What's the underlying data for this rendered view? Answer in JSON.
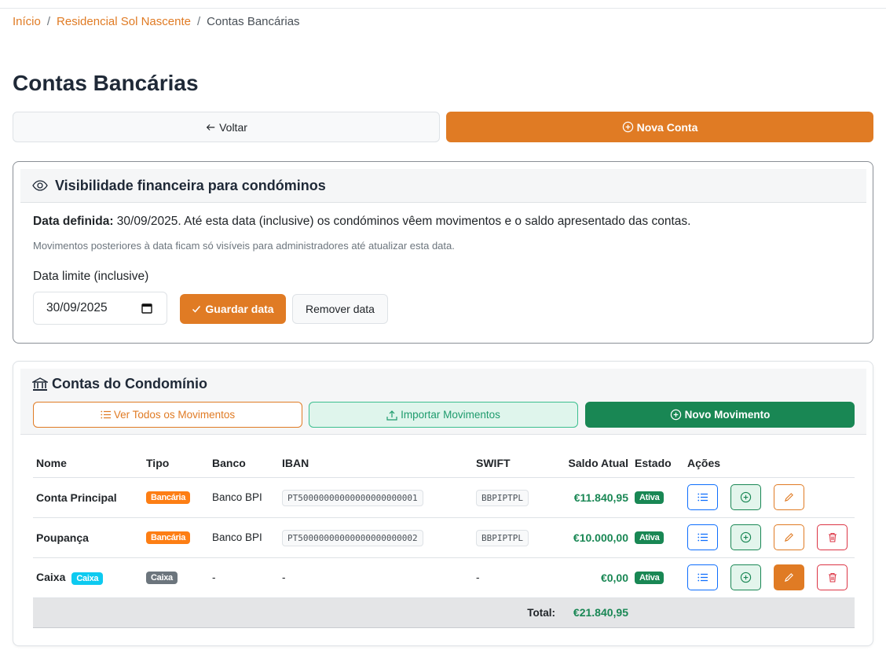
{
  "breadcrumb": {
    "home": "Início",
    "condo": "Residencial Sol Nascente",
    "current": "Contas Bancárias"
  },
  "page_title": "Contas Bancárias",
  "actions": {
    "back_label": "Voltar",
    "new_label": "Nova Conta"
  },
  "visibility": {
    "title": "Visibilidade financeira para condóminos",
    "defined_label": "Data definida:",
    "defined_text": " 30/09/2025. Até esta data (inclusive) os condóminos vêem movimentos e o saldo apresentado das contas.",
    "note": "Movimentos posteriores à data ficam só visíveis para administradores até atualizar esta data.",
    "limit_label": "Data limite (inclusive)",
    "date_value": "30/09/2025",
    "save_label": "Guardar data",
    "remove_label": "Remover data"
  },
  "accounts": {
    "title": "Contas do Condomínio",
    "btn_movements": "Ver Todos os Movimentos",
    "btn_import": "Importar Movimentos",
    "btn_new_movement": "Novo Movimento",
    "columns": {
      "name": "Nome",
      "type": "Tipo",
      "bank": "Banco",
      "iban": "IBAN",
      "swift": "SWIFT",
      "balance": "Saldo Atual",
      "state": "Estado",
      "actions": "Ações"
    },
    "rows": [
      {
        "name": "Conta Principal",
        "tag": "",
        "type": "Bancária",
        "bank": "Banco BPI",
        "iban": "PT50000000000000000000001",
        "swift": "BBPIPTPL",
        "balance": "€11.840,95",
        "state": "Ativa"
      },
      {
        "name": "Poupança",
        "tag": "",
        "type": "Bancária",
        "bank": "Banco BPI",
        "iban": "PT50000000000000000000002",
        "swift": "BBPIPTPL",
        "balance": "€10.000,00",
        "state": "Ativa"
      },
      {
        "name": "Caixa",
        "tag": "Caixa",
        "type": "Caixa",
        "bank": "-",
        "iban": "-",
        "swift": "-",
        "balance": "€0,00",
        "state": "Ativa"
      }
    ],
    "total_label": "Total:",
    "total_value": "€21.840,95"
  },
  "colors": {
    "accent": "#e07b24",
    "success": "#198754",
    "danger": "#dc3545",
    "primary": "#0d6efd"
  },
  "icons": [
    "arrow-left-icon",
    "plus-circle-icon",
    "eye-icon",
    "calendar-icon",
    "check-icon",
    "bank-icon",
    "list-icon",
    "upload-icon",
    "pencil-icon",
    "trash-icon"
  ]
}
